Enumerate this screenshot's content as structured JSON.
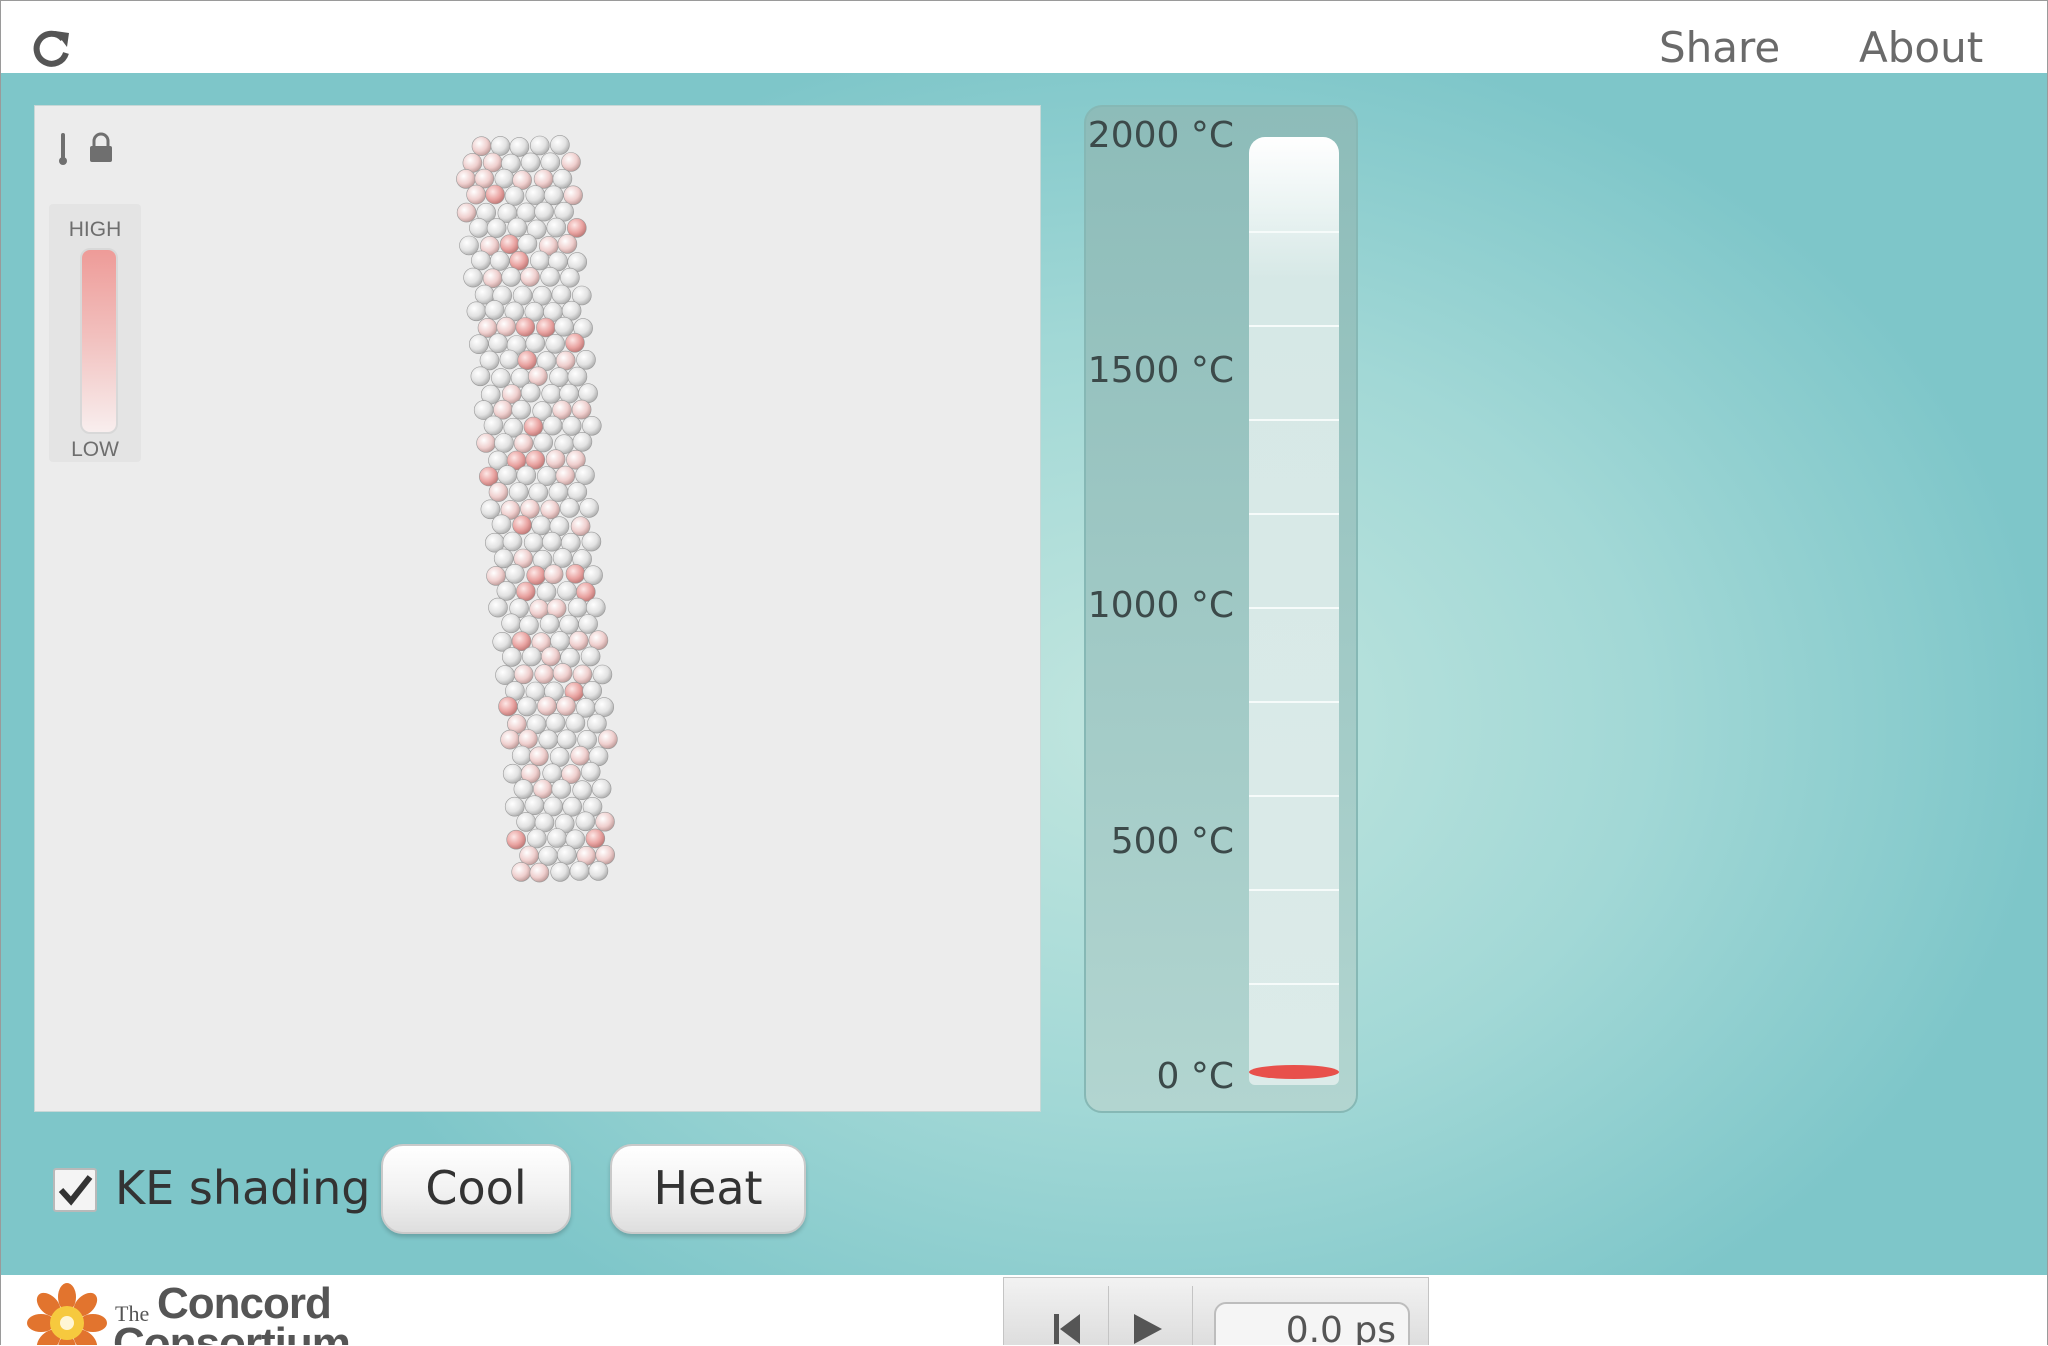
{
  "header": {
    "reload_icon": "reload-icon",
    "share_label": "Share",
    "about_label": "About"
  },
  "simulation": {
    "icons": [
      "thermometer-icon",
      "lock-icon"
    ],
    "ke_legend": {
      "high_label": "HIGH",
      "low_label": "LOW"
    },
    "colors": {
      "background": "#ececec",
      "atom": "#e6e6e6",
      "atom_hot": "#e07c7a"
    }
  },
  "thermometer": {
    "labels": [
      "2000 °C",
      "1500 °C",
      "1000 °C",
      "500 °C",
      "0 °C"
    ],
    "current_value_c": 0,
    "max_c": 2000,
    "mercury_color": "#e8504b"
  },
  "controls": {
    "ke_shading_label": "KE shading",
    "ke_shading_checked": true,
    "cool_label": "Cool",
    "heat_label": "Heat"
  },
  "footer": {
    "logo_the": "The",
    "logo_concord": "Concord",
    "logo_consortium": "Consortium",
    "time": "0.0 ps"
  }
}
